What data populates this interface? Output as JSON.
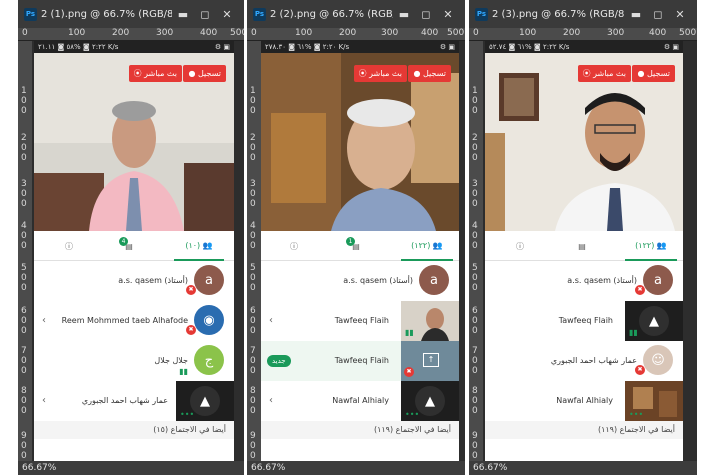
{
  "windows": [
    {
      "title": "2 (1).png @ 66.7% (RGB/8)",
      "zoom": "66.67%",
      "ruler_h": [
        "0",
        "100",
        "200",
        "300",
        "400",
        "500"
      ],
      "ruler_v": [
        "1 0 0",
        "2 0 0",
        "3 0 0",
        "4 0 0",
        "5 0 0",
        "6 0 0",
        "7 0 0",
        "8 0 0",
        "9 0 0"
      ],
      "status_text": "٢:٢٢ ◙ %٥٨ ◙ ٢١.١١ K/s",
      "record_label": "تسجيل",
      "live_label": "بث مباشر",
      "tab_participants": "(١٠)",
      "chat_badge": "4",
      "rows": [
        {
          "name": "a.s. qasem",
          "tag": "(أستاذ)",
          "avatar_letter": "a"
        },
        {
          "name": "Reem Mohmmed taeb Alhafode"
        },
        {
          "name": "جلال جلال",
          "avatar_letter": "ج"
        },
        {
          "name": "عمار شهاب احمد الجبوري"
        }
      ],
      "section_label": "أيضا في الاجتماع (١٥)"
    },
    {
      "title": "2 (2).png @ 66.7% (RGB/8)",
      "zoom": "66.67%",
      "ruler_h": [
        "0",
        "100",
        "200",
        "300",
        "400",
        "500"
      ],
      "ruler_v": [
        "1 0 0",
        "2 0 0",
        "3 0 0",
        "4 0 0",
        "5 0 0",
        "6 0 0",
        "7 0 0",
        "8 0 0",
        "9 0 0"
      ],
      "status_text": "٢:٢٠ ◙ %٦١ ◙ ٢٧٨.٣٠ K/s",
      "record_label": "تسجيل",
      "live_label": "بث مباشر",
      "tab_participants": "(١٢٢)",
      "chat_badge": "1",
      "rows": [
        {
          "name": "a.s. qasem",
          "tag": "(أستاذ)",
          "avatar_letter": "a"
        },
        {
          "name": "Tawfeeq Flaih"
        },
        {
          "name": "Tawfeeq Flaih",
          "new_label": "جديد"
        },
        {
          "name": "Nawfal Alhialy"
        }
      ],
      "section_label": "أيضا في الاجتماع (١١٩)"
    },
    {
      "title": "2 (3).png @ 66.7% (RGB/8)",
      "zoom": "66.67%",
      "ruler_h": [
        "0",
        "100",
        "200",
        "300",
        "400",
        "500"
      ],
      "ruler_v": [
        "1 0 0",
        "2 0 0",
        "3 0 0",
        "4 0 0",
        "5 0 0",
        "6 0 0",
        "7 0 0",
        "8 0 0",
        "9 0 0"
      ],
      "status_text": "٢:٢٢ ◙ %٦١ ◙ ٥٢.٧٤ K/s",
      "record_label": "تسجيل",
      "live_label": "بث مباشر",
      "tab_participants": "(١٢٢)",
      "chat_badge": "",
      "rows": [
        {
          "name": "a.s. qasem",
          "tag": "(أستاذ)",
          "avatar_letter": "a"
        },
        {
          "name": "Tawfeeq Flaih"
        },
        {
          "name": "عمار شهاب احمد الجبوري"
        },
        {
          "name": "Nawfal Alhialy"
        }
      ],
      "section_label": "أيضا في الاجتماع (١١٩)"
    }
  ],
  "colors": {
    "accent_green": "#1a9a5a",
    "record_red": "#e53935",
    "ps_chrome": "#3a3a3a"
  }
}
